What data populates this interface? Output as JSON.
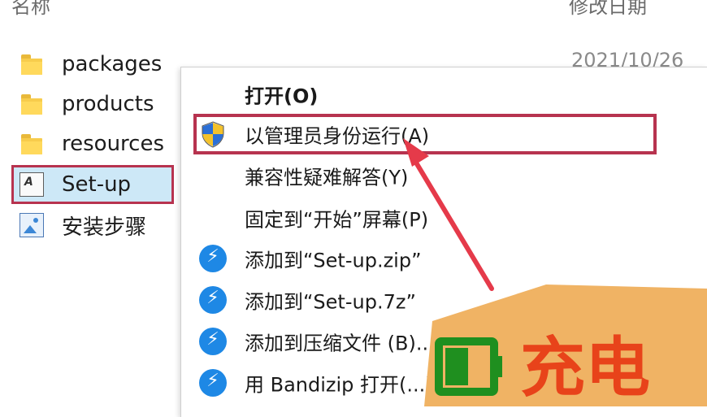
{
  "columns": {
    "name": "名称",
    "date_modified": "修改日期"
  },
  "files": [
    {
      "name": "packages",
      "icon": "folder-icon"
    },
    {
      "name": "products",
      "icon": "folder-icon"
    },
    {
      "name": "resources",
      "icon": "folder-icon"
    },
    {
      "name": "Set-up",
      "icon": "app-icon",
      "selected": true
    },
    {
      "name": "安装步骤",
      "icon": "image-icon"
    }
  ],
  "date_peek": "2021/10/26",
  "context_menu": {
    "items": [
      {
        "label": "打开(O)",
        "bold": true
      },
      {
        "label": "以管理员身份运行(A)",
        "icon": "shield-icon",
        "highlighted": true
      },
      {
        "label": "兼容性疑难解答(Y)"
      },
      {
        "label": "固定到“开始”屏幕(P)"
      },
      {
        "label": "添加到“Set-up.zip”",
        "icon": "bandizip-icon"
      },
      {
        "label": "添加到“Set-up.7z”",
        "icon": "bandizip-icon"
      },
      {
        "label": "添加到压缩文件 (B)...",
        "icon": "bandizip-icon"
      },
      {
        "label": "用 Bandizip 打开(...)",
        "icon": "bandizip-icon"
      }
    ]
  },
  "watermark": {
    "text": "充电",
    "battery_color": "#1f8f1f",
    "text_color": "#e8431a",
    "bg_color": "#f0b364"
  },
  "colors": {
    "highlight_border": "#b7334f",
    "selection_bg": "#cde8f7",
    "arrow": "#e53a4a"
  }
}
